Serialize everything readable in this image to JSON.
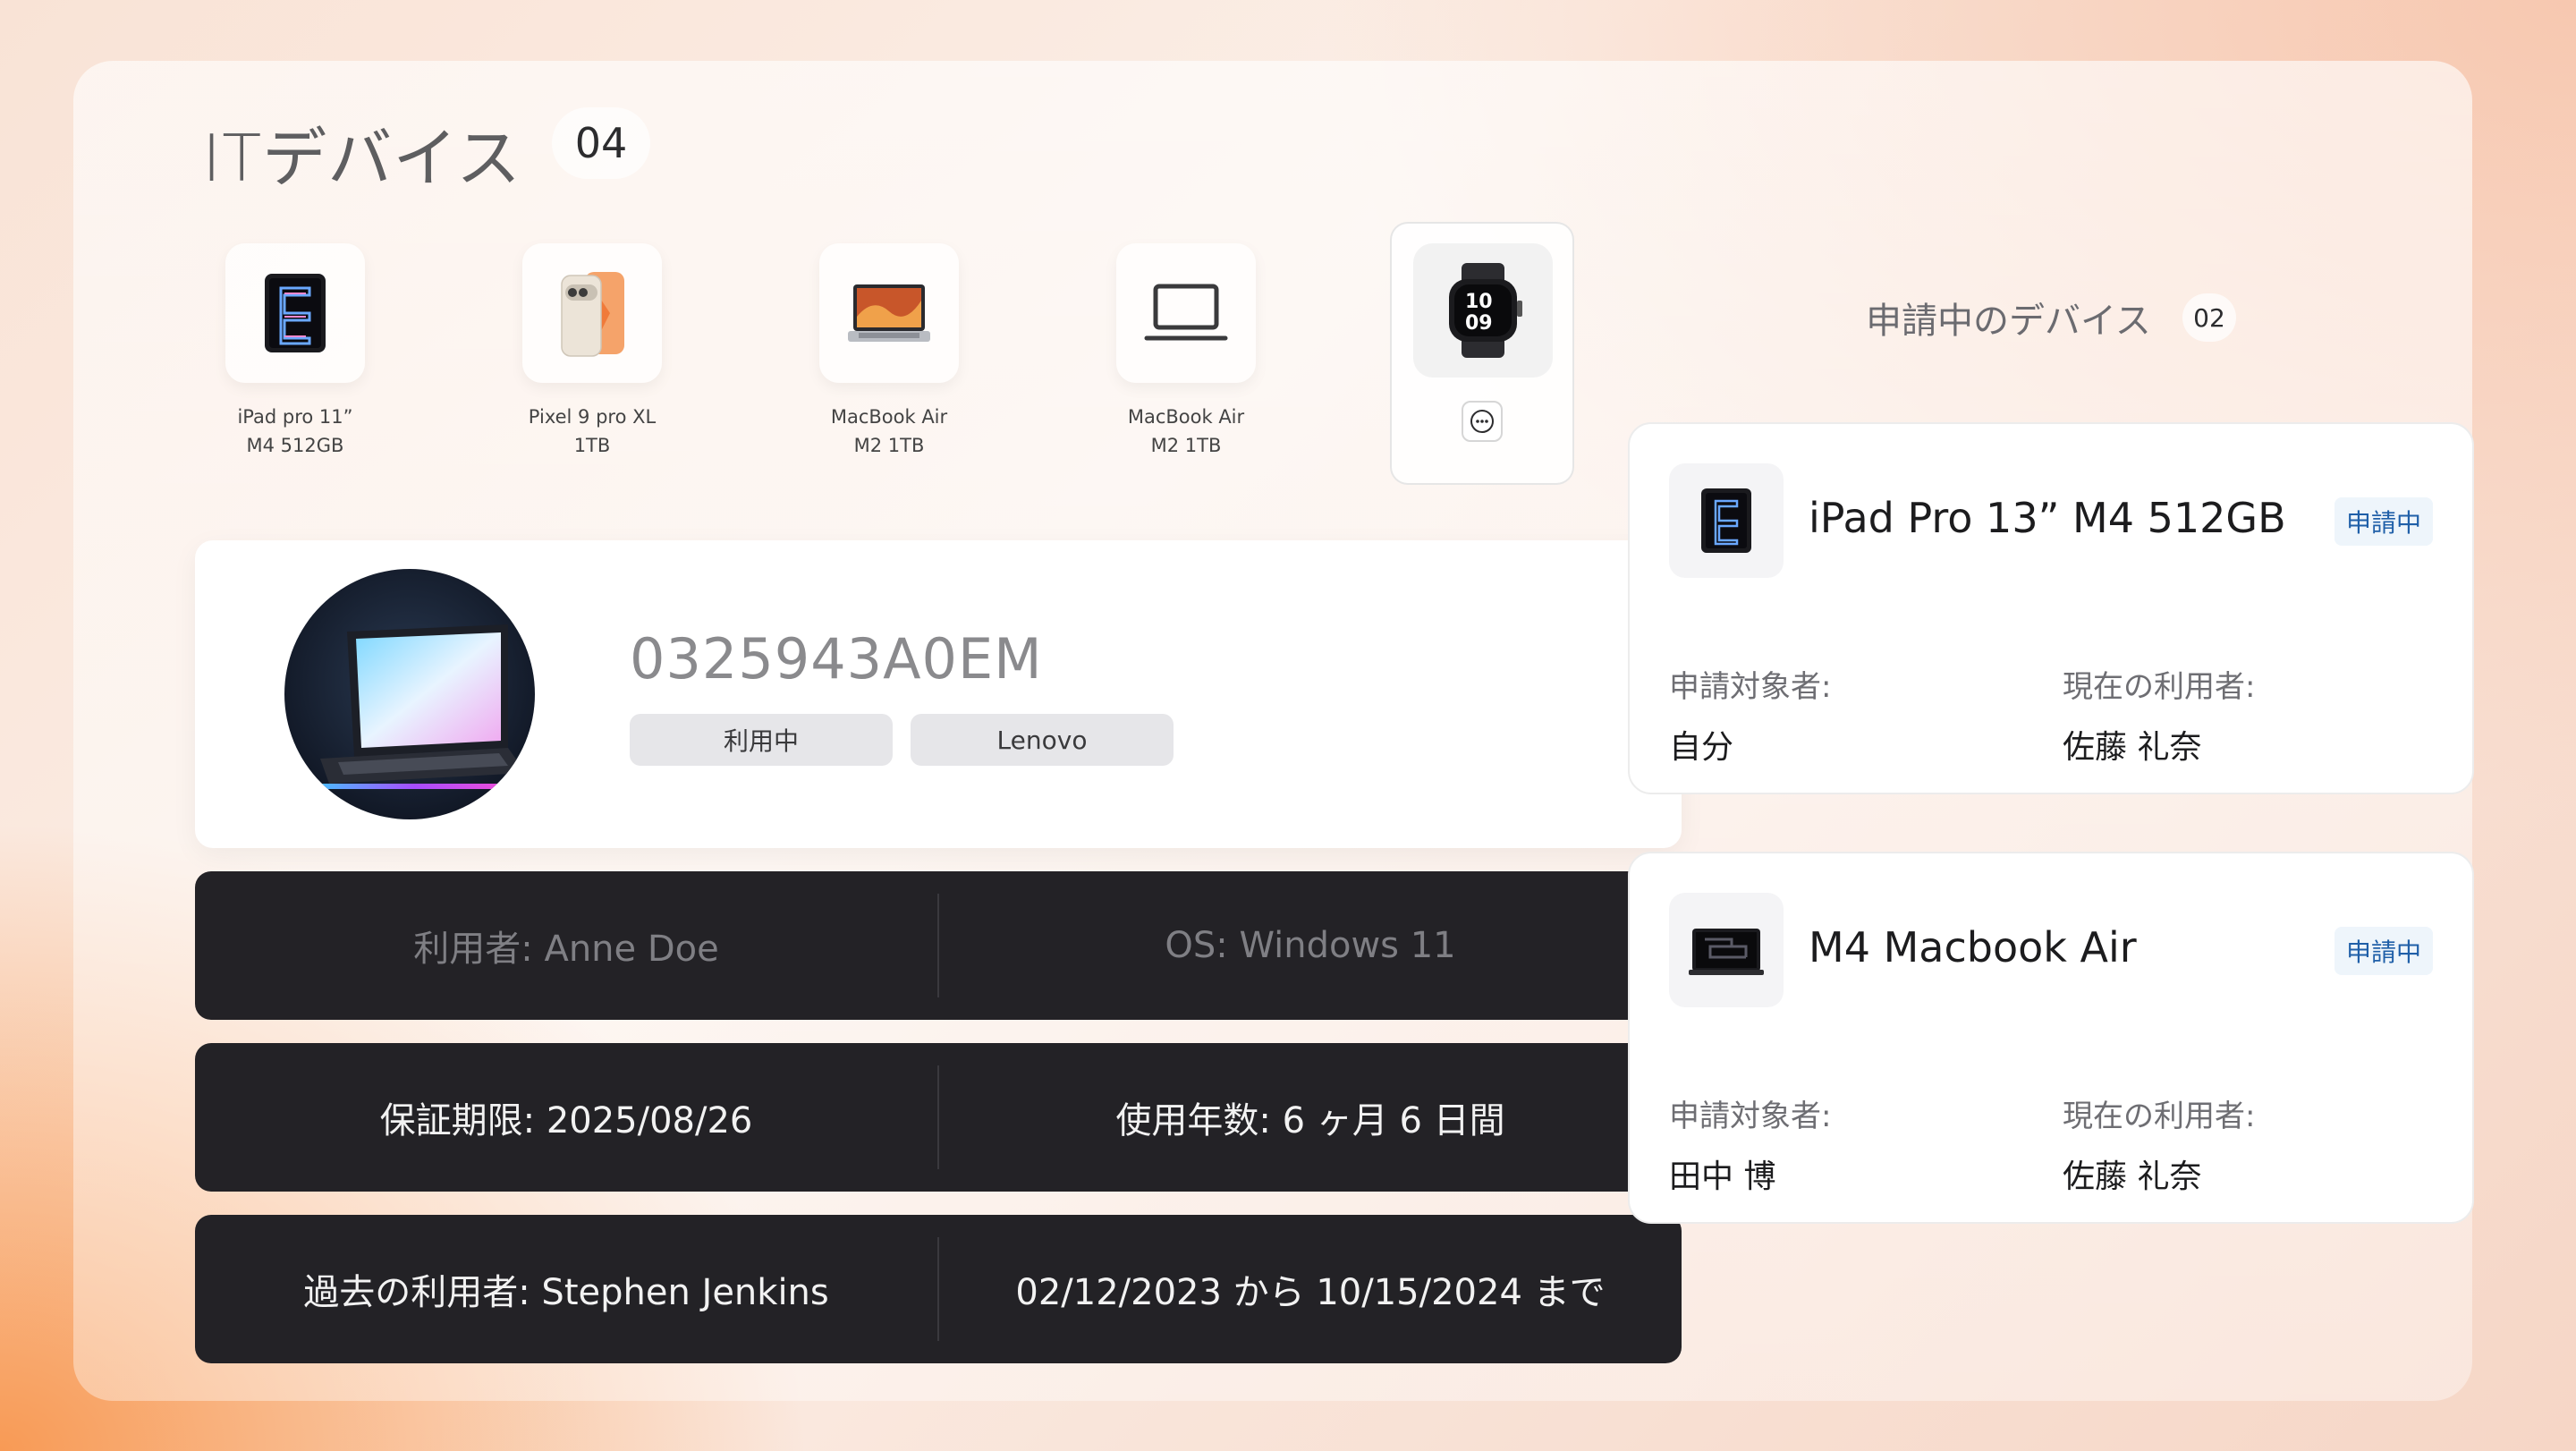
{
  "header": {
    "title": "ITデバイス",
    "count": "04"
  },
  "devices": [
    {
      "line1": "iPad pro 11”",
      "line2": "M4 512GB",
      "icon": "ipad-icon"
    },
    {
      "line1": "Pixel 9 pro XL",
      "line2": "1TB",
      "icon": "phone-icon"
    },
    {
      "line1": "MacBook Air",
      "line2": "M2 1TB",
      "icon": "macbook-icon"
    },
    {
      "line1": "MacBook Air",
      "line2": "M2 1TB",
      "icon": "laptop-outline-icon"
    },
    {
      "line1": "",
      "line2": "",
      "icon": "watch-icon",
      "selected": true
    }
  ],
  "detail": {
    "serial": "0325943A0EM",
    "tags": [
      "利用中",
      "Lenovo"
    ],
    "rows": [
      {
        "left": "利用者: Anne Doe",
        "right": "OS: Windows 11",
        "dim": true
      },
      {
        "left": "保証期限: 2025/08/26",
        "right": "使用年数: 6 ヶ月 6 日間"
      },
      {
        "left": "過去の利用者: Stephen Jenkins",
        "right": "02/12/2023 から 10/15/2024 まで"
      }
    ]
  },
  "requests": {
    "title": "申請中のデバイス",
    "count": "02",
    "items": [
      {
        "name": "iPad Pro 13” M4 512GB",
        "status": "申請中",
        "applicant_label": "申請対象者:",
        "applicant": "自分",
        "current_label": "現在の利用者:",
        "current": "佐藤 礼奈"
      },
      {
        "name": "M4 Macbook Air",
        "status": "申請中",
        "applicant_label": "申請対象者:",
        "applicant": "田中 博",
        "current_label": "現在の利用者:",
        "current": "佐藤 礼奈"
      }
    ]
  },
  "colors": {
    "badge_text": "#1f5fa8",
    "dark_bar": "#232226",
    "accent_orange": "#f89a55"
  }
}
